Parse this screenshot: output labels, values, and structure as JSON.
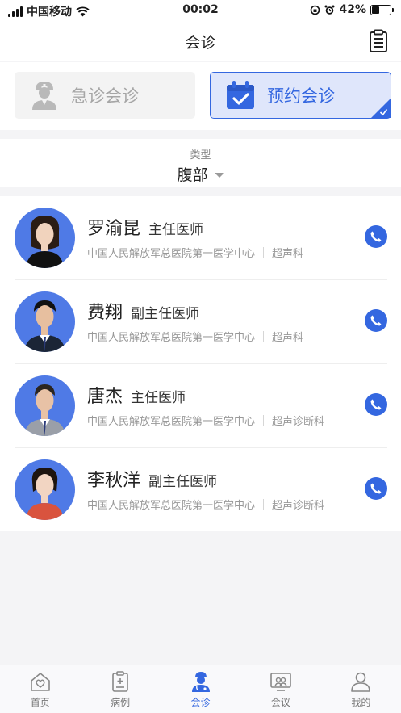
{
  "status_bar": {
    "carrier": "中国移动",
    "time": "00:02",
    "battery": "42%",
    "battery_level": 0.42
  },
  "nav": {
    "title": "会诊",
    "action_icon": "clipboard-icon"
  },
  "modes": {
    "emergency": {
      "label": "急诊会诊",
      "icon": "doctor-icon"
    },
    "appointment": {
      "label": "预约会诊",
      "icon": "calendar-check-icon",
      "selected": true
    }
  },
  "filter": {
    "label": "类型",
    "value": "腹部"
  },
  "doctors": [
    {
      "name": "罗渝昆",
      "title": "主任医师",
      "hospital": "中国人民解放军总医院第一医学中心",
      "department": "超声科"
    },
    {
      "name": "费翔",
      "title": "副主任医师",
      "hospital": "中国人民解放军总医院第一医学中心",
      "department": "超声科"
    },
    {
      "name": "唐杰",
      "title": "主任医师",
      "hospital": "中国人民解放军总医院第一医学中心",
      "department": "超声诊断科"
    },
    {
      "name": "李秋洋",
      "title": "副主任医师",
      "hospital": "中国人民解放军总医院第一医学中心",
      "department": "超声诊断科"
    }
  ],
  "tabs": [
    {
      "label": "首页",
      "icon": "home-icon"
    },
    {
      "label": "病例",
      "icon": "case-icon"
    },
    {
      "label": "会诊",
      "icon": "consultation-icon",
      "active": true
    },
    {
      "label": "会议",
      "icon": "meeting-icon"
    },
    {
      "label": "我的",
      "icon": "profile-icon"
    }
  ],
  "colors": {
    "accent": "#3467e0",
    "accent_light": "#dfe6fb",
    "muted": "#a6a6a6"
  }
}
